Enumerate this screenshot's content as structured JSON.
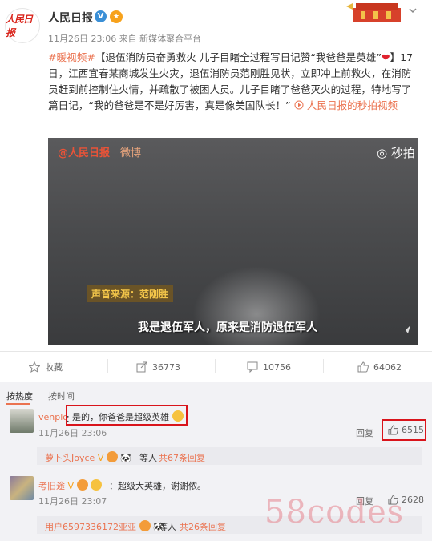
{
  "post": {
    "author": "人民日报",
    "avatar_text": "人民日报",
    "meta": "11月26日 23:06 来自 新媒体聚合平台",
    "hashtag": "#暖视频#",
    "title": "【退伍消防员奋勇救火 儿子目睹全过程写日记赞“我爸爸是英雄”",
    "title_end": "】",
    "body": "17日，江西宜春某商城发生火灾，退伍消防员范刚胜见状，立即冲上前救火，在消防员赶到前控制住火情，并疏散了被困人员。儿子目睹了爸爸灭火的过程，特地写了篇日记，“我的爸爸是不是好厉害，真是像美国队长！”",
    "link": "人民日报的秒拍视频"
  },
  "video": {
    "logo": "@人民日报",
    "logo2": "微博",
    "platform": "秒拍",
    "source": "声音来源：范刚胜",
    "subtitle": "我是退伍军人，原来是消防退伍军人"
  },
  "actions": {
    "favorite": "收藏",
    "repost": "36773",
    "comment": "10756",
    "like": "64062"
  },
  "sort": {
    "hot": "按热度",
    "time": "按时间"
  },
  "comments": [
    {
      "user": "venplo",
      "text": "是的，你爸爸是超级英雄",
      "time": "11月26日 23:06",
      "reply": "回复",
      "likes": "6515",
      "sub_user": "萝卜头Joyce",
      "sub_suffix": "等人",
      "sub_count": "共67条回复"
    },
    {
      "user": "考旧途",
      "text": "超级大英雄，谢谢侬。",
      "time": "11月26日 23:07",
      "reply": "回复",
      "likes": "2628",
      "sub_user": "用户6597336172亚亚",
      "sub_suffix": "等人",
      "sub_count": "共26条回复"
    }
  ],
  "watermark": "58codes",
  "colors": {
    "accent": "#eb7350",
    "highlight_box": "#d9141b",
    "verified": "#3a8fd6"
  }
}
